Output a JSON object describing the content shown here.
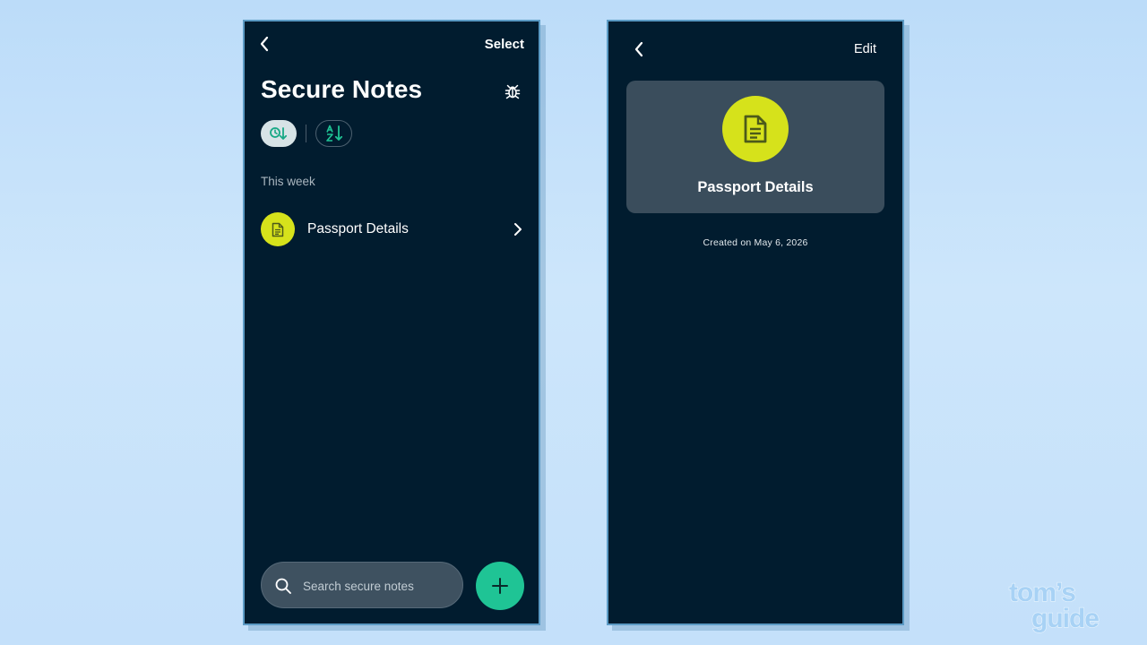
{
  "list_screen": {
    "select_label": "Select",
    "title": "Secure Notes",
    "section_label": "This week",
    "notes": [
      {
        "label": "Passport Details"
      }
    ],
    "search": {
      "placeholder": "Search secure notes",
      "value": ""
    }
  },
  "detail_screen": {
    "edit_label": "Edit",
    "note_title": "Passport Details",
    "created_label": "Created on May 6, 2026"
  },
  "watermark": {
    "line1": "tom's",
    "line2": "guide"
  },
  "colors": {
    "background": "#c4e0fa",
    "phone_bg": "#011c2f",
    "note_icon_bg": "#d6e21b",
    "accent_green": "#1fc495",
    "card_bg": "#3a4d5c"
  },
  "icons": [
    "back-chevron-icon",
    "bug-icon",
    "sort-by-date-icon",
    "sort-alphabetical-icon",
    "document-icon",
    "chevron-right-icon",
    "search-icon",
    "plus-icon"
  ]
}
